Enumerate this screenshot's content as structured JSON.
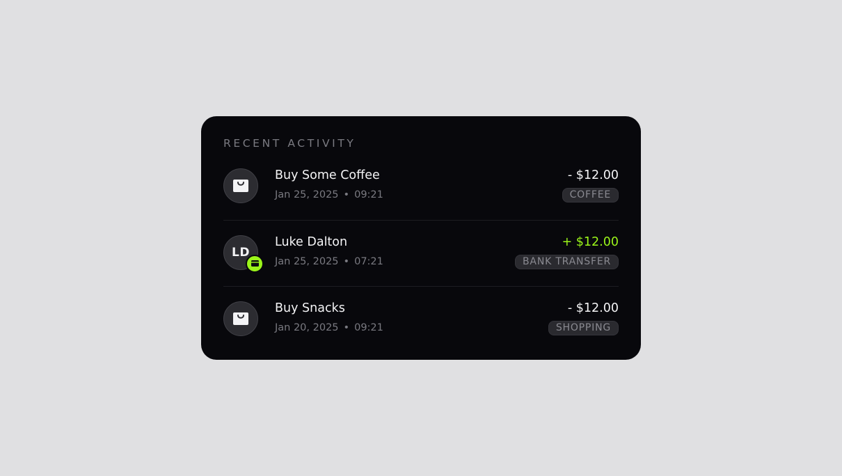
{
  "widget": {
    "title": "RECENT ACTIVITY"
  },
  "colors": {
    "background": "#e0e0e2",
    "card": "#08080c",
    "accent": "#9bf51a"
  },
  "transactions": [
    {
      "icon": "shopping-bag-icon",
      "name": "Buy Some Coffee",
      "date": "Jan 25, 2025",
      "time": "09:21",
      "amount": "- $12.00",
      "direction": "debit",
      "category": "COFFEE"
    },
    {
      "avatar_initials": "LD",
      "badge_icon": "card-icon",
      "name": "Luke Dalton",
      "date": "Jan 25, 2025",
      "time": "07:21",
      "amount": "+ $12.00",
      "direction": "credit",
      "category": "BANK TRANSFER"
    },
    {
      "icon": "shopping-bag-icon",
      "name": "Buy Snacks",
      "date": "Jan 20, 2025",
      "time": "09:21",
      "amount": "- $12.00",
      "direction": "debit",
      "category": "SHOPPING"
    }
  ]
}
